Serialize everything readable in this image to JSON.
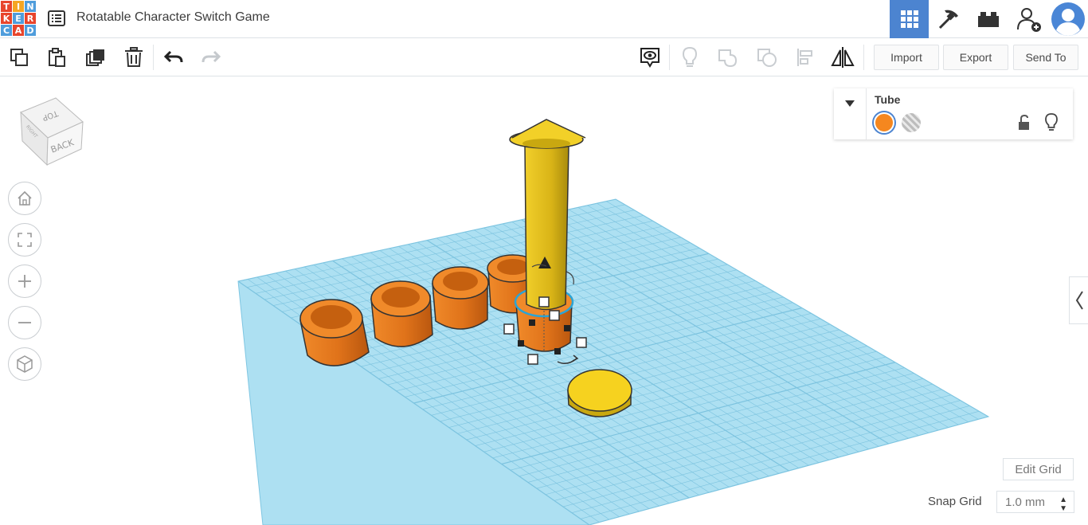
{
  "app": {
    "title": "Rotatable Character Switch Game",
    "logo_letters": [
      "T",
      "I",
      "N",
      "K",
      "E",
      "R",
      "C",
      "A",
      "D"
    ],
    "logo_colors": [
      "#e8452c",
      "#f5a623",
      "#4f9ddc",
      "#e8452c",
      "#4f9ddc",
      "#e8452c",
      "#4f9ddc",
      "#e8452c",
      "#4f9ddc"
    ]
  },
  "top_icons": [
    {
      "name": "3d-design-grid-icon",
      "active": true
    },
    {
      "name": "pickaxe-icon",
      "active": false
    },
    {
      "name": "bricks-icon",
      "active": false
    },
    {
      "name": "add-user-icon",
      "active": false
    },
    {
      "name": "avatar-icon",
      "active": false
    }
  ],
  "toolbar": {
    "copy": "copy-icon",
    "paste": "paste-icon",
    "duplicate": "duplicate-icon",
    "delete": "trash-icon",
    "undo": "undo-icon",
    "redo": "redo-icon",
    "import_label": "Import",
    "export_label": "Export",
    "send_to_label": "Send To"
  },
  "viewcube": {
    "top_label": "TOP",
    "back_label": "BACK",
    "right_label": "RIGHT"
  },
  "nav": [
    "home-icon",
    "fit-view-icon",
    "zoom-in-icon",
    "zoom-out-icon",
    "perspective-icon"
  ],
  "inspector": {
    "shape_name": "Tube",
    "solid_color": "#f5871f"
  },
  "grid": {
    "edit_label": "Edit Grid",
    "snap_label": "Snap Grid",
    "snap_value": "1.0 mm"
  },
  "colors": {
    "accent": "#4c84d0",
    "workplane": "#a8dcef",
    "orange": "#e8781f",
    "yellow": "#e8c41c"
  }
}
